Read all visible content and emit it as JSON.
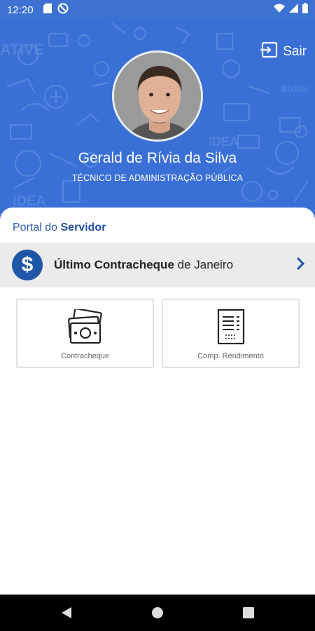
{
  "status_bar": {
    "time": "12:20",
    "icons": [
      "sd-card-icon",
      "do-not-disturb-icon",
      "wifi-icon",
      "signal-icon",
      "battery-icon"
    ]
  },
  "header": {
    "logout_label": "Sair",
    "user_name": "Gerald de Rívia da Silva",
    "user_role": "TÉCNICO DE ADMINISTRAÇÃO PÚBLICA",
    "background_color": "#3a70d6"
  },
  "portal": {
    "title_prefix": "Portal do",
    "title_bold": "Servidor"
  },
  "last_paycheck": {
    "currency_symbol": "$",
    "label_bold": "Último Contracheque",
    "label_rest": "de Janeiro"
  },
  "tiles": [
    {
      "label": "Contracheque",
      "icon": "money-icon"
    },
    {
      "label": "Comp. Rendimento",
      "icon": "document-icon"
    }
  ],
  "colors": {
    "accent": "#1e56a8",
    "header": "#3a70d6",
    "row_bg": "#ebebeb"
  },
  "nav_bar": {
    "buttons": [
      "back-button",
      "home-button",
      "recents-button"
    ]
  }
}
